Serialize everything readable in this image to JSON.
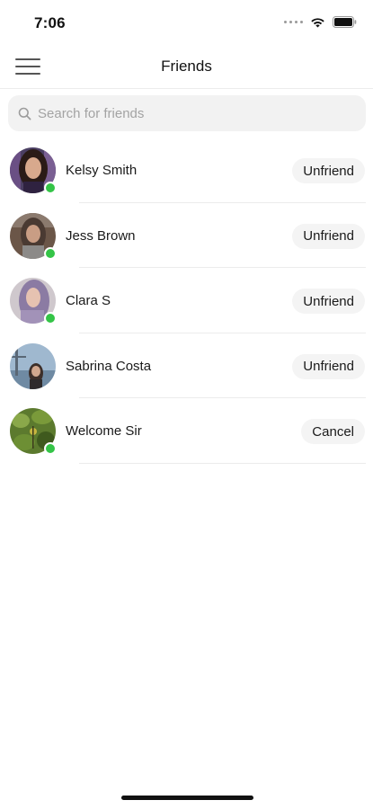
{
  "status_bar": {
    "time": "7:06"
  },
  "header": {
    "title": "Friends",
    "menu_icon": "hamburger-menu-icon"
  },
  "search": {
    "placeholder": "Search for friends",
    "value": "",
    "icon": "search-icon"
  },
  "friends": [
    {
      "name": "Kelsy Smith",
      "action": "Unfriend",
      "online": true
    },
    {
      "name": "Jess Brown",
      "action": "Unfriend",
      "online": true
    },
    {
      "name": "Clara S",
      "action": "Unfriend",
      "online": true
    },
    {
      "name": "Sabrina Costa",
      "action": "Unfriend",
      "online": false
    },
    {
      "name": "Welcome Sir",
      "action": "Cancel",
      "online": true
    }
  ],
  "colors": {
    "online": "#34c447",
    "button_bg": "#f4f4f4",
    "search_bg": "#f2f2f2"
  }
}
